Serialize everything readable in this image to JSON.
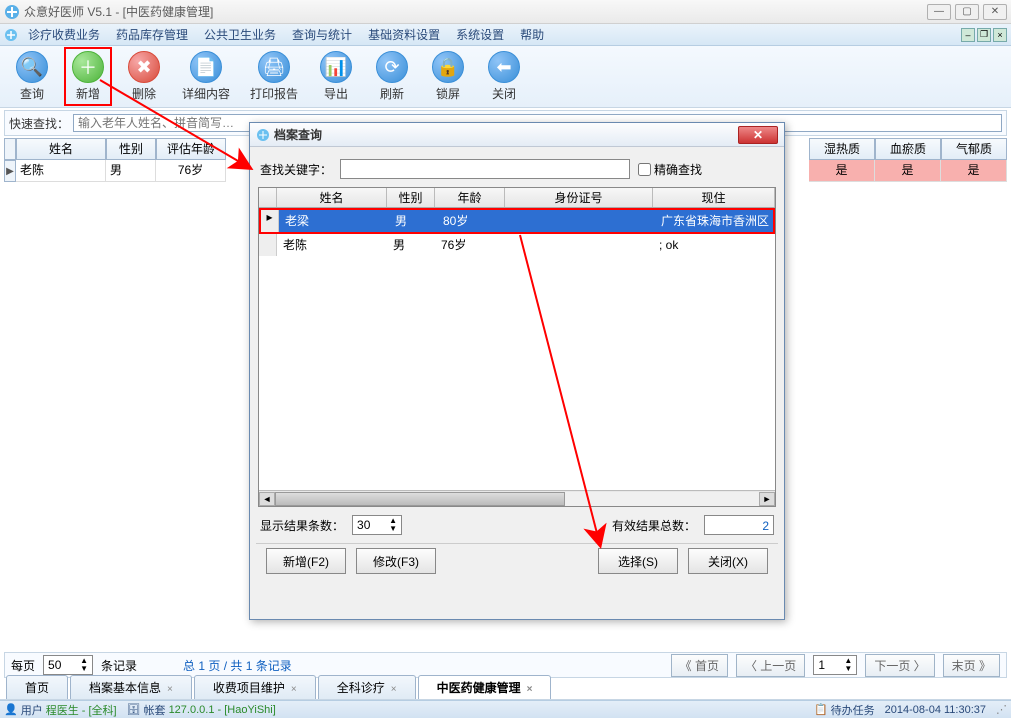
{
  "window": {
    "title": "众意好医师 V5.1 - [中医药健康管理]"
  },
  "menu": {
    "items": [
      "诊疗收费业务",
      "药品库存管理",
      "公共卫生业务",
      "查询与统计",
      "基础资料设置",
      "系统设置",
      "帮助"
    ]
  },
  "toolbar": {
    "query": "查询",
    "add": "新增",
    "delete": "删除",
    "detail": "详细内容",
    "print": "打印报告",
    "export": "导出",
    "refresh": "刷新",
    "lock": "锁屏",
    "close": "关闭"
  },
  "quicksearch": {
    "label": "快速查找：",
    "placeholder": "输入老年人姓名、拼音简写…"
  },
  "main_table": {
    "headers": {
      "name": "姓名",
      "gender": "性别",
      "age": "评估年龄",
      "shire": "湿热质",
      "xueyu": "血瘀质",
      "qiyu": "气郁质"
    },
    "row": {
      "name": "老陈",
      "gender": "男",
      "age": "76岁",
      "shire": "是",
      "xueyu": "是",
      "qiyu": "是"
    }
  },
  "dialog": {
    "title": "档案查询",
    "search_label": "查找关键字：",
    "exact_label": "精确查找",
    "headers": {
      "name": "姓名",
      "gender": "性别",
      "age": "年龄",
      "id": "身份证号",
      "addr": "现住"
    },
    "rows": [
      {
        "name": "老梁",
        "gender": "男",
        "age": "80岁",
        "id": "",
        "addr": "广东省珠海市香洲区"
      },
      {
        "name": "老陈",
        "gender": "男",
        "age": "76岁",
        "id": "",
        "addr": "; ok"
      }
    ],
    "result_count_label": "显示结果条数：",
    "result_count_value": "30",
    "total_label": "有效结果总数：",
    "total_value": "2",
    "btn_add": "新增(F2)",
    "btn_edit": "修改(F3)",
    "btn_select": "选择(S)",
    "btn_close": "关闭(X)"
  },
  "pagination": {
    "perpage_label": "每页",
    "perpage_value": "50",
    "records_label": "条记录",
    "summary": "总 1 页 / 共 1 条记录",
    "first": "《 首页",
    "prev": "〈 上一页",
    "page_value": "1",
    "next": "下一页 〉",
    "last": "末页 》"
  },
  "tabs": {
    "home": "首页",
    "archive": "档案基本信息",
    "fee": "收费项目维护",
    "clinic": "全科诊疗",
    "tcm": "中医药健康管理"
  },
  "status": {
    "user_label": "用户",
    "user_value": "程医生 - [全科]",
    "acct_label": "帐套",
    "acct_value": "127.0.0.1 - [HaoYiShi]",
    "task_label": "待办任务",
    "datetime": "2014-08-04 11:30:37"
  }
}
